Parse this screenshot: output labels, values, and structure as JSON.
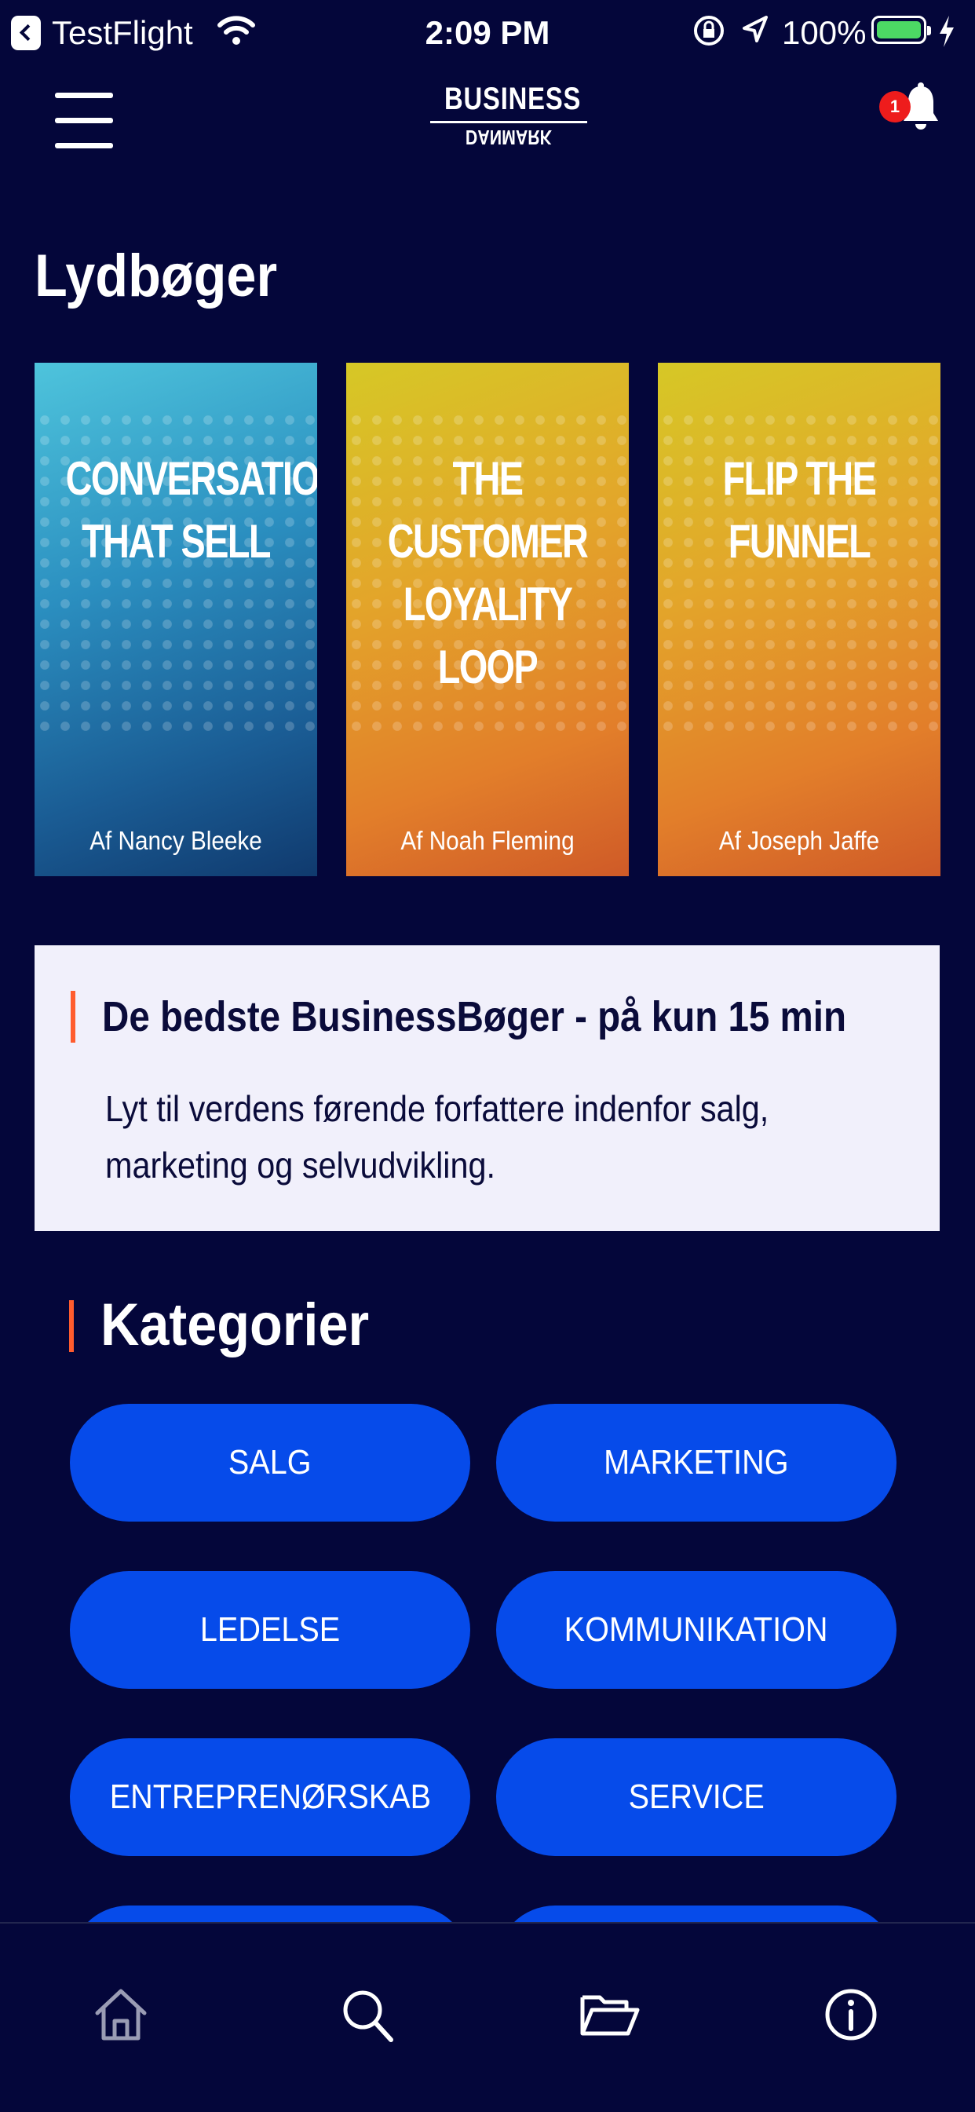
{
  "status_bar": {
    "carrier": "TestFlight",
    "time": "2:09 PM",
    "battery_percent": "100%"
  },
  "header": {
    "logo_top": "BUSINESS",
    "logo_bottom": "DANMARK",
    "notification_count": "1"
  },
  "page_title": "Lydbøger",
  "books": [
    {
      "title": "CONVERSATIONS THAT SELL",
      "author": "Af Nancy Bleeke"
    },
    {
      "title": "THE CUSTOMER LOYALITY LOOP",
      "author": "Af Noah Fleming"
    },
    {
      "title": "FLIP THE FUNNEL",
      "author": "Af Joseph Jaffe"
    }
  ],
  "promo": {
    "title": "De bedste BusinessBøger - på kun 15 min",
    "description": "Lyt til verdens førende forfattere indenfor salg, marketing og selvudvikling."
  },
  "categories": {
    "title": "Kategorier",
    "items": [
      "SALG",
      "MARKETING",
      "LEDELSE",
      "KOMMUNIKATION",
      "ENTREPRENØRSKAB",
      "SERVICE"
    ]
  },
  "tab_bar": {
    "items": [
      "home-icon",
      "search-icon",
      "folder-icon",
      "info-icon"
    ]
  },
  "colors": {
    "background": "#04063a",
    "pill": "#064bea",
    "accent_bar": "#ff5c2e",
    "promo_bg": "#f1f0fb",
    "badge": "#ee1c1c"
  }
}
